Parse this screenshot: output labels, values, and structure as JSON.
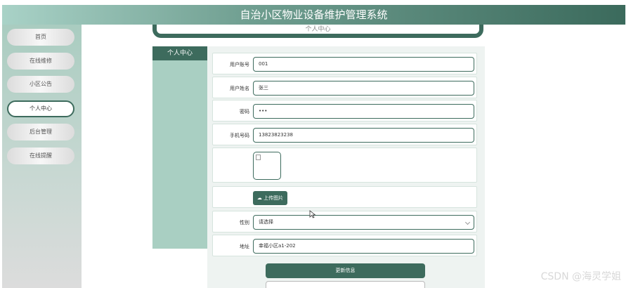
{
  "header": {
    "title": "自治小区物业设备维护管理系统"
  },
  "sidebar": {
    "items": [
      {
        "label": "首页"
      },
      {
        "label": "在线维修"
      },
      {
        "label": "小区公告"
      },
      {
        "label": "个人中心"
      },
      {
        "label": "后台管理"
      },
      {
        "label": "在线提醒"
      }
    ],
    "active": "个人中心"
  },
  "top_tab": {
    "label": "个人中心"
  },
  "mini_col": {
    "title": "个人中心"
  },
  "form": {
    "account": {
      "label": "用户账号",
      "value": "001"
    },
    "name": {
      "label": "用户姓名",
      "value": "张三"
    },
    "password": {
      "label": "密码",
      "value": "•••"
    },
    "phone": {
      "label": "手机号码",
      "value": "13823823238"
    },
    "upload_label": "上传图片",
    "gender": {
      "label": "性别",
      "value": "请选择"
    },
    "address": {
      "label": "地址",
      "value": "幸福小区a1-202"
    },
    "update_label": "更新信息"
  },
  "watermark": "CSDN @海灵学姐",
  "colors": {
    "accent": "#3d6b5d",
    "sidebar_top": "#a9ccc0"
  }
}
